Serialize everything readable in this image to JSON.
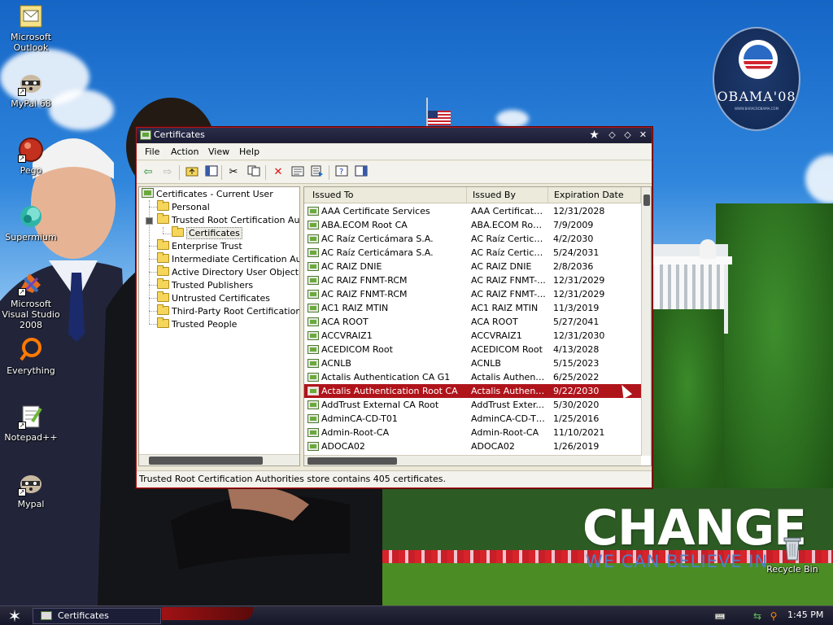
{
  "desktop": {
    "icons": [
      {
        "label": "Microsoft Outlook",
        "icon": "outlook-icon"
      },
      {
        "label": "MyPal 68",
        "icon": "mypal-raccoon-icon"
      },
      {
        "label": "Pego",
        "icon": "pego-icon"
      },
      {
        "label": "Supermium",
        "icon": "supermium-icon"
      },
      {
        "label": "Microsoft Visual Studio 2008",
        "icon": "visual-studio-icon"
      },
      {
        "label": "Everything",
        "icon": "everything-search-icon"
      },
      {
        "label": "Notepad++",
        "icon": "notepadpp-icon"
      },
      {
        "label": "Mypal",
        "icon": "mypal-raccoon-icon"
      }
    ],
    "recycle_bin_label": "Recycle Bin",
    "wallpaper": {
      "logo_text": "OBAMA'08",
      "logo_subtext": "WWW.BARACKOBAMA.COM",
      "headline": "CHANGE",
      "subheadline": "WE CAN BELIEVE IN"
    }
  },
  "window": {
    "title": "Certificates",
    "controls": [
      "pin-icon",
      "minimize-icon",
      "maximize-icon",
      "close-icon"
    ],
    "menu": [
      "File",
      "Action",
      "View",
      "Help"
    ],
    "toolbar_icons": [
      "back-arrow-icon",
      "forward-arrow-icon",
      "up-folder-icon",
      "show-hide-tree-icon",
      "cut-icon",
      "copy-icon",
      "delete-icon",
      "properties-icon",
      "export-list-icon",
      "help-icon",
      "show-hide-action-pane-icon"
    ],
    "tree": {
      "root": "Certificates - Current User",
      "items": [
        {
          "label": "Personal",
          "level": 1,
          "expanded": false
        },
        {
          "label": "Trusted Root Certification Authc",
          "level": 1,
          "expanded": true
        },
        {
          "label": "Certificates",
          "level": 2,
          "selected": true
        },
        {
          "label": "Enterprise Trust",
          "level": 1
        },
        {
          "label": "Intermediate Certification Authc",
          "level": 1
        },
        {
          "label": "Active Directory User Object",
          "level": 1
        },
        {
          "label": "Trusted Publishers",
          "level": 1
        },
        {
          "label": "Untrusted Certificates",
          "level": 1
        },
        {
          "label": "Third-Party Root Certification Au",
          "level": 1
        },
        {
          "label": "Trusted People",
          "level": 1
        }
      ]
    },
    "list": {
      "columns": [
        "Issued To",
        "Issued By",
        "Expiration Date"
      ],
      "rows": [
        {
          "issued_to": "AAA Certificate Services",
          "issued_by": "AAA Certificate...",
          "expires": "12/31/2028"
        },
        {
          "issued_to": "ABA.ECOM Root CA",
          "issued_by": "ABA.ECOM Roo...",
          "expires": "7/9/2009"
        },
        {
          "issued_to": "AC Raíz Certicámara S.A.",
          "issued_by": "AC Raíz Certicá...",
          "expires": "4/2/2030"
        },
        {
          "issued_to": "AC Raíz Certicámara S.A.",
          "issued_by": "AC Raíz Certicá...",
          "expires": "5/24/2031"
        },
        {
          "issued_to": "AC RAIZ DNIE",
          "issued_by": "AC RAIZ DNIE",
          "expires": "2/8/2036"
        },
        {
          "issued_to": "AC RAIZ FNMT-RCM",
          "issued_by": "AC RAIZ FNMT-...",
          "expires": "12/31/2029"
        },
        {
          "issued_to": "AC RAIZ FNMT-RCM",
          "issued_by": "AC RAIZ FNMT-...",
          "expires": "12/31/2029"
        },
        {
          "issued_to": "AC1 RAIZ MTIN",
          "issued_by": "AC1 RAIZ MTIN",
          "expires": "11/3/2019"
        },
        {
          "issued_to": "ACA ROOT",
          "issued_by": "ACA ROOT",
          "expires": "5/27/2041"
        },
        {
          "issued_to": "ACCVRAIZ1",
          "issued_by": "ACCVRAIZ1",
          "expires": "12/31/2030"
        },
        {
          "issued_to": "ACEDICOM Root",
          "issued_by": "ACEDICOM Root",
          "expires": "4/13/2028"
        },
        {
          "issued_to": "ACNLB",
          "issued_by": "ACNLB",
          "expires": "5/15/2023"
        },
        {
          "issued_to": "Actalis Authentication CA G1",
          "issued_by": "Actalis Authenti...",
          "expires": "6/25/2022"
        },
        {
          "issued_to": "Actalis Authentication Root CA",
          "issued_by": "Actalis Authenti...",
          "expires": "9/22/2030",
          "selected": true
        },
        {
          "issued_to": "AddTrust External CA Root",
          "issued_by": "AddTrust Exter...",
          "expires": "5/30/2020"
        },
        {
          "issued_to": "AdminCA-CD-T01",
          "issued_by": "AdminCA-CD-T01",
          "expires": "1/25/2016"
        },
        {
          "issued_to": "Admin-Root-CA",
          "issued_by": "Admin-Root-CA",
          "expires": "11/10/2021"
        },
        {
          "issued_to": "ADOCA02",
          "issued_by": "ADOCA02",
          "expires": "1/26/2019"
        }
      ]
    },
    "status": "Trusted Root Certification Authorities store contains 405 certificates."
  },
  "taskbar": {
    "start_icon": "star-start-icon",
    "tasks": [
      {
        "label": "Certificates",
        "icon": "certificate-icon"
      }
    ],
    "tray_icons": [
      "keyboard-icon",
      "network-icon",
      "search-icon"
    ],
    "clock": "1:45 PM"
  },
  "colors": {
    "selection": "#b0141b",
    "titlebar": "#1b1c33",
    "window_border": "#b01515"
  }
}
